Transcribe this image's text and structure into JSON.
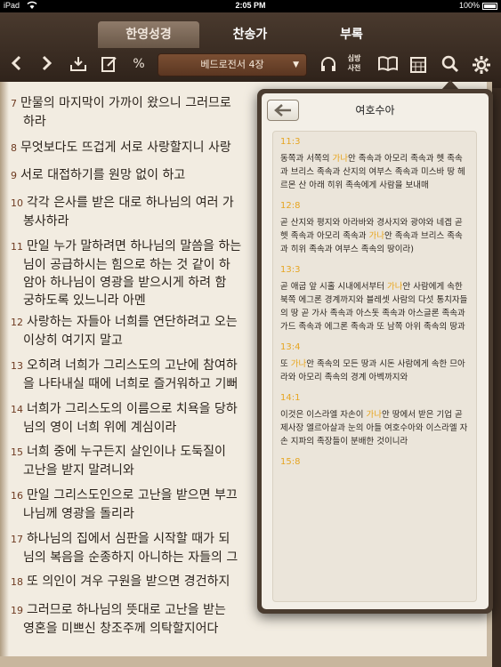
{
  "status_bar": {
    "carrier": "iPad",
    "time": "2:05 PM",
    "battery": "100%"
  },
  "tabs": [
    {
      "label": "한영성경",
      "active": true
    },
    {
      "label": "찬송가",
      "active": false
    },
    {
      "label": "부록",
      "active": false
    }
  ],
  "toolbar": {
    "chapter": "베드로전서 4장",
    "dict_label_top": "심방",
    "dict_label_bottom": "사전"
  },
  "verses": [
    {
      "num": "7",
      "lines": [
        "만물의 마지막이 가까이 왔으니 그러므로",
        "하라"
      ]
    },
    {
      "num": "8",
      "lines": [
        "무엇보다도 뜨겁게 서로 사랑할지니 사랑"
      ]
    },
    {
      "num": "9",
      "lines": [
        "서로 대접하기를 원망 없이 하고"
      ]
    },
    {
      "num": "10",
      "lines": [
        "각각 은사를 받은 대로 하나님의 여러 가",
        "봉사하라"
      ]
    },
    {
      "num": "11",
      "lines": [
        "만일 누가 말하려면 하나님의 말씀을 하는",
        "님이 공급하시는 힘으로 하는 것 같이 하",
        "암아 하나님이 영광을 받으시게 하려 함",
        "궁하도록 있느니라 아멘"
      ]
    },
    {
      "num": "12",
      "lines": [
        "사랑하는 자들아 너희를 연단하려고 오는",
        "이상히 여기지 말고"
      ]
    },
    {
      "num": "13",
      "lines": [
        "오히려 너희가 그리스도의 고난에 참여하",
        "을 나타내실 때에 너희로 즐거워하고 기뻐"
      ]
    },
    {
      "num": "14",
      "lines": [
        "너희가 그리스도의 이름으로 치욕을 당하",
        "님의 영이 너희 위에 계심이라"
      ]
    },
    {
      "num": "15",
      "lines": [
        "너희 중에 누구든지 살인이나 도둑질이",
        "고난을 받지 말려니와"
      ]
    },
    {
      "num": "16",
      "lines": [
        "만일 그리스도인으로 고난을 받으면 부끄",
        "나님께 영광을 돌리라"
      ]
    },
    {
      "num": "17",
      "lines": [
        "하나님의 집에서 심판을 시작할 때가 되",
        "님의 복음을 순종하지 아니하는 자들의 그"
      ]
    },
    {
      "num": "18",
      "lines": [
        "또 의인이 겨우 구원을 받으면 경건하지"
      ]
    },
    {
      "num": "19",
      "lines": [
        "그러므로 하나님의 뜻대로 고난을 받는",
        "영혼을 미쁘신 창조주께 의탁할지어다"
      ]
    }
  ],
  "popover": {
    "title": "여호수아",
    "results": [
      {
        "ref": "11:3",
        "segments": [
          "동쪽과 서쪽의 ",
          "가나",
          "안 족속과 아모리 족속과 헷 족속과 브리스 족속과 산지의 여부스 족속과 미스바 땅 헤르몬 산 아래 히위 족속에게 사람을 보내매"
        ]
      },
      {
        "ref": "12:8",
        "segments": [
          "곧 산지와 평지와 아라바와 경사지와 광야와 네겝 곧 헷 족속과 아모리 족속과 ",
          "가나",
          "안 족속과 브리스 족속과 히위 족속과 여부스 족속의 땅이라)"
        ]
      },
      {
        "ref": "13:3",
        "segments": [
          "곧 애굽 앞 시홀 시내에서부터 ",
          "가나",
          "안 사람에게 속한 북쪽 에그론 경계까지와 블레셋 사람의 다섯 통치자들의 땅 곧 가사 족속과 아스돗 족속과 아스글론 족속과 가드 족속과 에그론 족속과 또 남쪽 아위 족속의 땅과"
        ]
      },
      {
        "ref": "13:4",
        "segments": [
          "또 ",
          "가나",
          "안 족속의 모든 땅과 시돈 사람에게 속한 므아라와 아모리 족속의 경계 아벡까지와"
        ]
      },
      {
        "ref": "14:1",
        "segments": [
          "이것은 이스라엘 자손이 ",
          "가나",
          "안 땅에서 받은 기업 곧 제사장 엘르아살과 눈의 아들 여호수아와 이스라엘 자손 지파의 족장들이 분배한 것이니라"
        ]
      },
      {
        "ref": "15:8",
        "segments": [
          ""
        ]
      }
    ]
  }
}
